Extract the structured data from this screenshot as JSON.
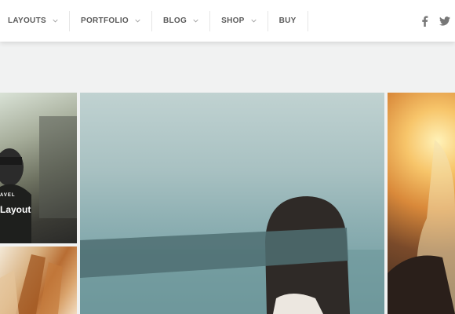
{
  "nav": {
    "items": [
      {
        "label": "LAYOUTS",
        "has_dropdown": true
      },
      {
        "label": "PORTFOLIO",
        "has_dropdown": true
      },
      {
        "label": "BLOG",
        "has_dropdown": true
      },
      {
        "label": "SHOP",
        "has_dropdown": true
      },
      {
        "label": "BUY",
        "has_dropdown": false
      }
    ],
    "social": [
      {
        "icon": "facebook-icon"
      },
      {
        "icon": "twitter-icon"
      }
    ]
  },
  "portfolio": {
    "featured_tile": {
      "category": "AVEL",
      "title": "Layout"
    }
  },
  "colors": {
    "nav_background": "#ffffff",
    "page_background": "#f1f2f2",
    "nav_text": "#5a5a5a"
  }
}
